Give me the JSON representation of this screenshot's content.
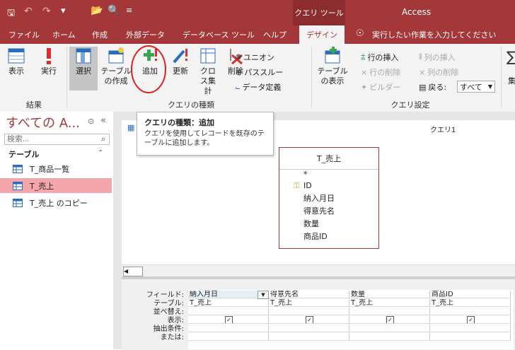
{
  "titlebar": {
    "context_tools": "クエリ ツール",
    "app_name": "Access"
  },
  "tabs": [
    "ファイル",
    "ホーム",
    "作成",
    "外部データ",
    "データベース ツール",
    "ヘルプ",
    "デザイン"
  ],
  "tell_me": "実行したい作業を入力してください",
  "ribbon": {
    "results": {
      "label": "結果",
      "view": "表示",
      "run": "実行"
    },
    "query_type": {
      "label": "クエリの種類",
      "select": "選択",
      "make_table": "テーブルの作成",
      "append": "追加",
      "update": "更新",
      "crosstab": "クロス集計",
      "delete": "削除",
      "union": "ユニオン",
      "passthrough": "パススルー",
      "data_def": "データ定義"
    },
    "query_setup": {
      "label": "クエリ設定",
      "show_table": "テーブルの表示",
      "insert_rows": "行の挿入",
      "delete_rows": "行の削除",
      "builder": "ビルダー",
      "insert_cols": "列の挿入",
      "delete_cols": "列の削除",
      "return": "戻る:",
      "return_value": "すべて"
    },
    "extra": "集"
  },
  "tooltip": {
    "title": "クエリの種類：追加",
    "body": "クエリを使用してレコードを既存のテーブルに追加します。"
  },
  "nav": {
    "title": "すべての A...",
    "search_placeholder": "検索...",
    "section": "テーブル",
    "items": [
      "T_商品一覧",
      "T_売上",
      "T_売上 のコピー"
    ]
  },
  "query": {
    "tab_title": "クエリ1",
    "table_name": "T_売上",
    "fields": [
      "*",
      "ID",
      "納入月日",
      "得意先名",
      "数量",
      "商品ID"
    ]
  },
  "grid": {
    "row_labels": [
      "フィールド:",
      "テーブル:",
      "並べ替え:",
      "表示:",
      "抽出条件:",
      "または:"
    ],
    "columns": [
      {
        "field": "納入月日",
        "table": "T_売上"
      },
      {
        "field": "得意先名",
        "table": "T_売上"
      },
      {
        "field": "数量",
        "table": "T_売上"
      },
      {
        "field": "商品ID",
        "table": "T_売上"
      }
    ]
  }
}
